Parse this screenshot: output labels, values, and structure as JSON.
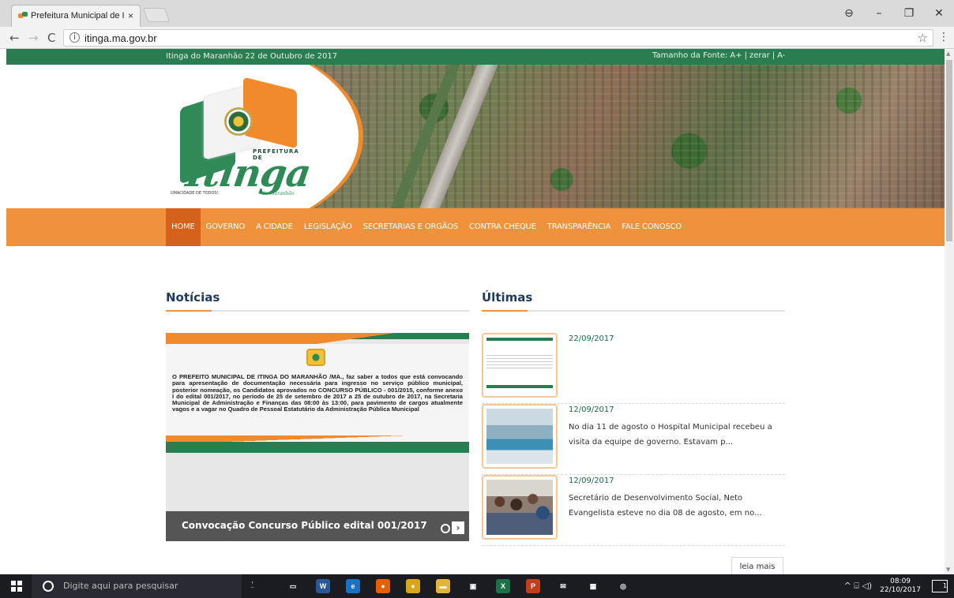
{
  "browser": {
    "tab_title": "Prefeitura Municipal de I",
    "tab_close": "×",
    "url": "itinga.ma.gov.br",
    "icons": {
      "back": "arrow-left-icon",
      "forward": "arrow-right-icon",
      "reload": "reload-icon",
      "info": "info-icon",
      "bookmark": "star-icon",
      "menu": "kebab-menu-icon",
      "profile": "profile-icon"
    },
    "window_controls": {
      "profile": "⊖",
      "minimize": "–",
      "maximize": "❐",
      "close": "✕"
    }
  },
  "site": {
    "top_date": "Itinga do Maranhão 22 de Outubro de 2017",
    "font_controls": {
      "label": "Tamanho da Fonte:",
      "increase": "A+",
      "sep1": "|",
      "reset": "zerar",
      "sep2": "|",
      "decrease": "A-"
    },
    "logo": {
      "prefeitura": "PREFEITURA DE",
      "name": "Itinga",
      "motto": "UMACIDADE DE TODOS!",
      "sub": "do Maranhão"
    },
    "nav": [
      "HOME",
      "GOVERNO",
      "A CIDADE",
      "LEGISLAÇÃO",
      "SECRETARIAS E ORGÃOS",
      "CONTRA CHEQUE",
      "TRANSPARÊNCIA",
      "FALE CONOSCO"
    ],
    "nav_active": "HOME",
    "colors": {
      "green": "#2a7d51",
      "orange": "#f0923c",
      "orange_dark": "#d4621b",
      "title": "#1f3a5a"
    }
  },
  "noticias": {
    "title": "Notícias",
    "featured": {
      "body": "O PREFEITO MUNICIPAL DE ITINGA DO MARANHÃO /MA., faz saber a todos que está convocando para apresentação de documentação necessária para ingresso no serviço público municipal, posterior nomeação, os Candidatos aprovados no CONCURSO PÚBLICO - 001/2015, conforme anexo I do edital 001/2017, no período de 25 de setembro de 2017 a 25 de outubro de 2017, na Secretaria Municipal de Administração e Finanças das 08:00 às 13:00, para pavimento de cargos atualmente vagos e a vagar no Quadro de Pessoal Estatutário da Administração Pública Municipal",
      "caption": "Convocação Concurso Público edital 001/2017",
      "next": "›"
    }
  },
  "ultimas": {
    "title": "Últimas",
    "items": [
      {
        "date": "22/09/2017",
        "text": "",
        "thumb": "document-thumbnail"
      },
      {
        "date": "12/09/2017",
        "text": "No dia 11 de agosto o Hospital Municipal recebeu a visita da equipe de governo. Estavam p...",
        "thumb": "hospital-thumbnail"
      },
      {
        "date": "12/09/2017",
        "text": "Secretário de Desenvolvimento Social, Neto Evangelista esteve no dia 08 de agosto, em no...",
        "thumb": "crowd-thumbnail"
      }
    ],
    "more": "leia mais"
  },
  "taskbar": {
    "search_placeholder": "Digite aqui para pesquisar",
    "apps": [
      {
        "name": "task-view-icon",
        "glyph": "▭",
        "color": "#1b1b22"
      },
      {
        "name": "word-icon",
        "glyph": "W",
        "color": "#2b5797"
      },
      {
        "name": "edge-icon",
        "glyph": "e",
        "color": "#1b6fc4"
      },
      {
        "name": "firefox-icon",
        "glyph": "●",
        "color": "#e66000"
      },
      {
        "name": "chrome-icon",
        "glyph": "●",
        "color": "#d9a51a"
      },
      {
        "name": "file-explorer-icon",
        "glyph": "▬",
        "color": "#e2b53a"
      },
      {
        "name": "store-icon",
        "glyph": "▣",
        "color": "#1b1b22"
      },
      {
        "name": "excel-icon",
        "glyph": "X",
        "color": "#1e7145"
      },
      {
        "name": "powerpoint-icon",
        "glyph": "P",
        "color": "#c43e1c"
      },
      {
        "name": "mail-icon",
        "glyph": "✉",
        "color": "#1b1b22"
      },
      {
        "name": "calculator-icon",
        "glyph": "▦",
        "color": "#1b1b22"
      },
      {
        "name": "media-icon",
        "glyph": "◎",
        "color": "#1b1b22"
      }
    ],
    "tray_symbols": "^ ⌸ ◁)",
    "time": "08:09",
    "date": "22/10/2017",
    "notification_count": "1"
  }
}
